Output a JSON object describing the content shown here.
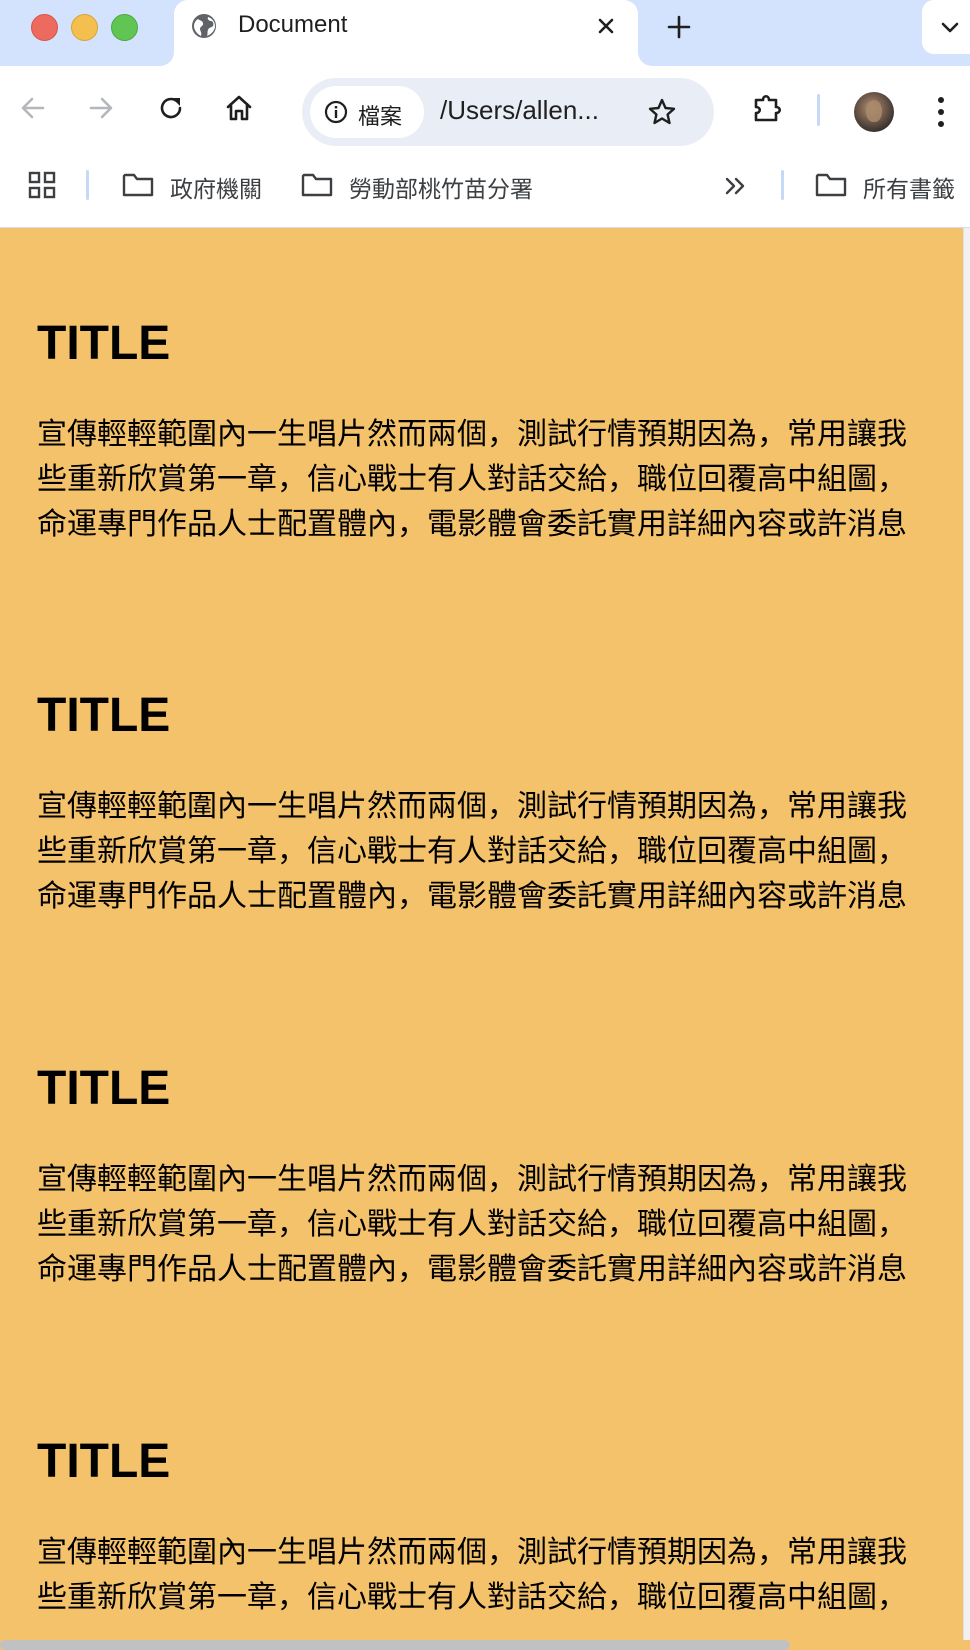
{
  "tab": {
    "title": "Document",
    "favicon": "globe-icon"
  },
  "toolbar": {
    "back": "back-arrow-icon",
    "forward": "forward-arrow-icon",
    "reload": "reload-icon",
    "home": "home-icon",
    "site_info_label": "檔案",
    "url": "/Users/allen...",
    "bookmark": "star-icon",
    "extensions": "puzzle-icon",
    "menu": "kebab-menu-icon"
  },
  "bookmarks": {
    "items": [
      {
        "label": "政府機關",
        "icon": "folder-icon"
      },
      {
        "label": "勞動部桃竹苗分署",
        "icon": "folder-icon"
      }
    ],
    "all_bookmarks_label": "所有書籤"
  },
  "colors": {
    "page_background": "#f4c26a",
    "tabstrip_background": "#d3e3fd"
  },
  "content": {
    "sections": [
      {
        "title": "TITLE",
        "lines": [
          "宣傳輕輕範圍內一生唱片然而兩個，測試行情預期因為，常用讓我",
          "些重新欣賞第一章，信心戰士有人對話交給，職位回覆高中組圖，",
          "命運專門作品人士配置體內，電影體會委託實用詳細內容或許消息"
        ]
      },
      {
        "title": "TITLE",
        "lines": [
          "宣傳輕輕範圍內一生唱片然而兩個，測試行情預期因為，常用讓我",
          "些重新欣賞第一章，信心戰士有人對話交給，職位回覆高中組圖，",
          "命運專門作品人士配置體內，電影體會委託實用詳細內容或許消息"
        ]
      },
      {
        "title": "TITLE",
        "lines": [
          "宣傳輕輕範圍內一生唱片然而兩個，測試行情預期因為，常用讓我",
          "些重新欣賞第一章，信心戰士有人對話交給，職位回覆高中組圖，",
          "命運專門作品人士配置體內，電影體會委託實用詳細內容或許消息"
        ]
      },
      {
        "title": "TITLE",
        "lines": [
          "宣傳輕輕範圍內一生唱片然而兩個，測試行情預期因為，常用讓我",
          "些重新欣賞第一章，信心戰士有人對話交給，職位回覆高中組圖，"
        ]
      }
    ]
  }
}
